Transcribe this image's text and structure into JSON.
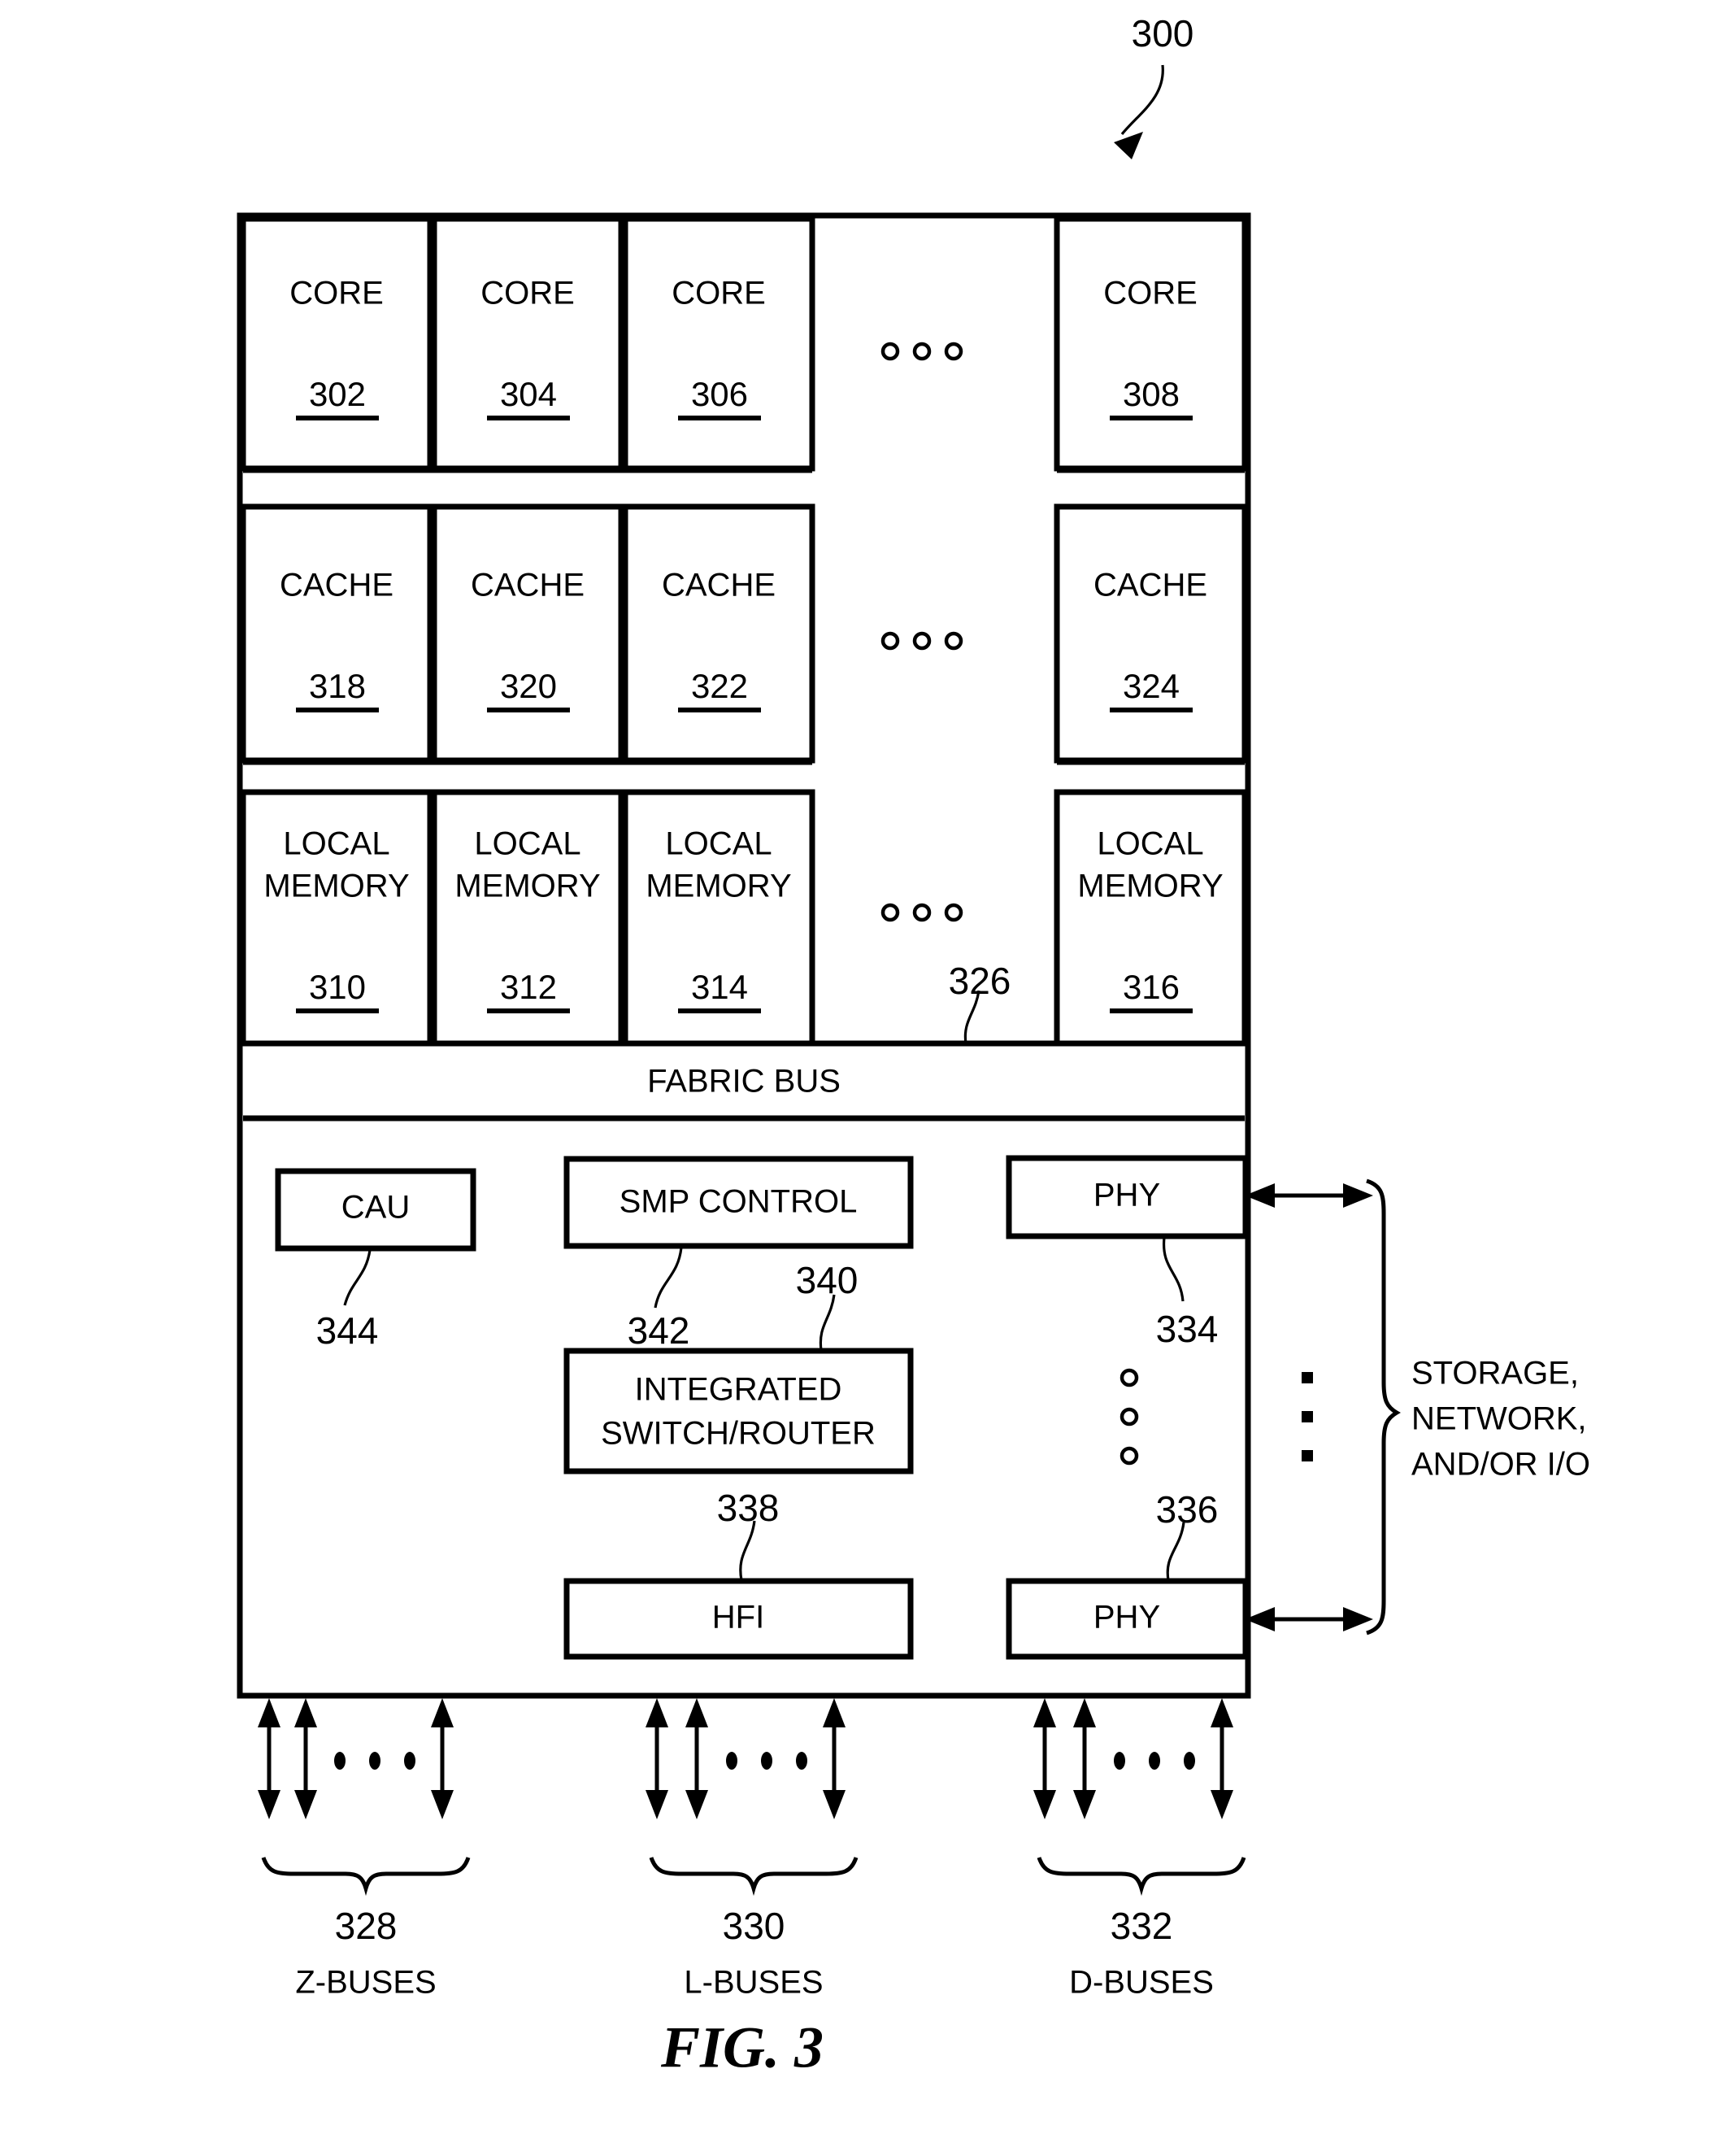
{
  "figure": {
    "caption": "FIG. 3",
    "reference_numeral": "300"
  },
  "rows": {
    "core": {
      "label": "CORE",
      "boxes": [
        {
          "label": "CORE",
          "ref": "302"
        },
        {
          "label": "CORE",
          "ref": "304"
        },
        {
          "label": "CORE",
          "ref": "306"
        },
        {
          "label": "CORE",
          "ref": "308"
        }
      ],
      "ellipsis": "o o o"
    },
    "cache": {
      "label": "CACHE",
      "boxes": [
        {
          "label": "CACHE",
          "ref": "318"
        },
        {
          "label": "CACHE",
          "ref": "320"
        },
        {
          "label": "CACHE",
          "ref": "322"
        },
        {
          "label": "CACHE",
          "ref": "324"
        }
      ],
      "ellipsis": "o o o"
    },
    "local_memory": {
      "label_line1": "LOCAL",
      "label_line2": "MEMORY",
      "boxes": [
        {
          "line1": "LOCAL",
          "line2": "MEMORY",
          "ref": "310"
        },
        {
          "line1": "LOCAL",
          "line2": "MEMORY",
          "ref": "312"
        },
        {
          "line1": "LOCAL",
          "line2": "MEMORY",
          "ref": "314"
        },
        {
          "line1": "LOCAL",
          "line2": "MEMORY",
          "ref": "316"
        }
      ],
      "gap_ref": "326",
      "ellipsis": "o o o"
    }
  },
  "fabric_bus": {
    "label": "FABRIC BUS"
  },
  "controllers": {
    "cau": {
      "label": "CAU",
      "ref": "344"
    },
    "smp_control": {
      "label": "SMP CONTROL",
      "ref": "342"
    },
    "integrated_switch_router": {
      "line1": "INTEGRATED",
      "line2": "SWITCH/ROUTER",
      "ref": "340"
    },
    "hfi": {
      "label": "HFI",
      "ref": "338"
    },
    "phy_top": {
      "label": "PHY",
      "ref": "334"
    },
    "phy_bottom": {
      "label": "PHY",
      "ref": "336"
    }
  },
  "external": {
    "line1": "STORAGE,",
    "line2": "NETWORK,",
    "line3": "AND/OR I/O"
  },
  "buses": [
    {
      "ref": "328",
      "label": "Z-BUSES"
    },
    {
      "ref": "330",
      "label": "L-BUSES"
    },
    {
      "ref": "332",
      "label": "D-BUSES"
    }
  ]
}
